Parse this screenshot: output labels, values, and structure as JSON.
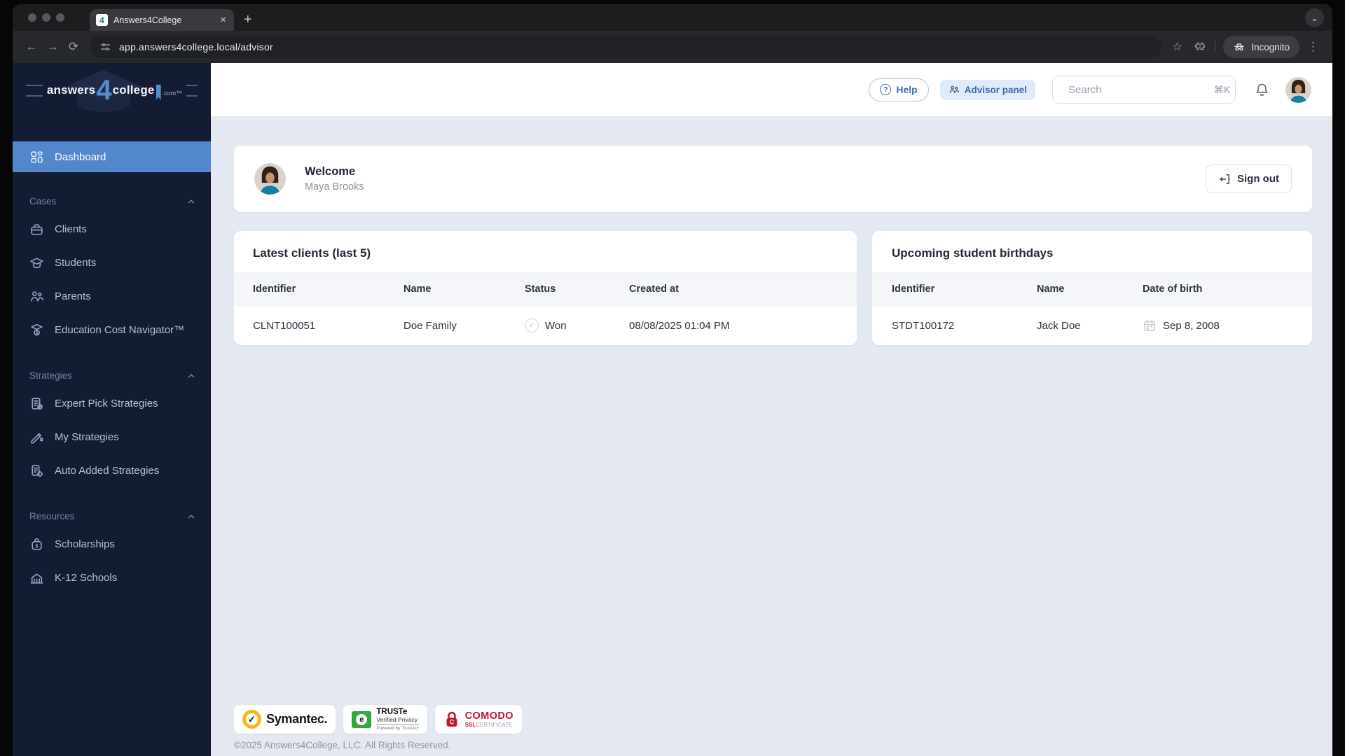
{
  "browser": {
    "tab_title": "Answers4College",
    "url": "app.answers4college.local/advisor",
    "incognito_label": "Incognito"
  },
  "icons": {
    "back": "←",
    "forward": "→",
    "reload": "⟳",
    "star": "☆",
    "kebab": "⋮",
    "close": "×",
    "new_tab": "+",
    "tab_search": "⌄",
    "favicon_glyph": "4",
    "check": "✓",
    "help_mark": "?",
    "symantec_check": "✓",
    "truste_e": "e"
  },
  "sidebar": {
    "logo": {
      "part1": "answers",
      "part2": "4",
      "part3": "college",
      "part4": ".com™"
    },
    "dashboard_label": "Dashboard",
    "sections": [
      {
        "label": "Cases",
        "items": [
          {
            "label": "Clients"
          },
          {
            "label": "Students"
          },
          {
            "label": "Parents"
          },
          {
            "label": "Education Cost Navigator™"
          }
        ]
      },
      {
        "label": "Strategies",
        "items": [
          {
            "label": "Expert Pick Strategies"
          },
          {
            "label": "My Strategies"
          },
          {
            "label": "Auto Added Strategies"
          }
        ]
      },
      {
        "label": "Resources",
        "items": [
          {
            "label": "Scholarships"
          },
          {
            "label": "K-12 Schools"
          }
        ]
      }
    ]
  },
  "header": {
    "help_label": "Help",
    "advisor_panel_label": "Advisor panel",
    "search_placeholder": "Search",
    "search_shortcut": "⌘K"
  },
  "welcome": {
    "title": "Welcome",
    "name": "Maya Brooks",
    "sign_out_label": "Sign out"
  },
  "latest_clients": {
    "title": "Latest clients (last 5)",
    "columns": [
      "Identifier",
      "Name",
      "Status",
      "Created at"
    ],
    "rows": [
      {
        "identifier": "CLNT100051",
        "name": "Doe Family",
        "status": "Won",
        "created_at": "08/08/2025 01:04 PM"
      }
    ]
  },
  "birthdays": {
    "title": "Upcoming student birthdays",
    "columns": [
      "Identifier",
      "Name",
      "Date of birth"
    ],
    "rows": [
      {
        "identifier": "STDT100172",
        "name": "Jack Doe",
        "dob": "Sep 8, 2008"
      }
    ]
  },
  "footer": {
    "symantec_text": "Symantec.",
    "truste": {
      "line1": "TRUSTe",
      "line2": "Verified Privacy",
      "line3": "Powered by TrustArc"
    },
    "comodo": {
      "line1": "COMODO",
      "line2": "SSL",
      "line3": "CERTIFICATE"
    },
    "copyright": "©2025 Answers4College, LLC. All Rights Reserved."
  },
  "colors": {
    "accent_blue": "#5288cb",
    "logo_blue": "#4f8fd0",
    "sidebar_bg": "#141c33",
    "main_bg": "#e3e8f1",
    "help_blue": "#3e6cab",
    "symantec_yellow": "#f9b712",
    "truste_green": "#31a83a",
    "comodo_red": "#c8102e"
  }
}
